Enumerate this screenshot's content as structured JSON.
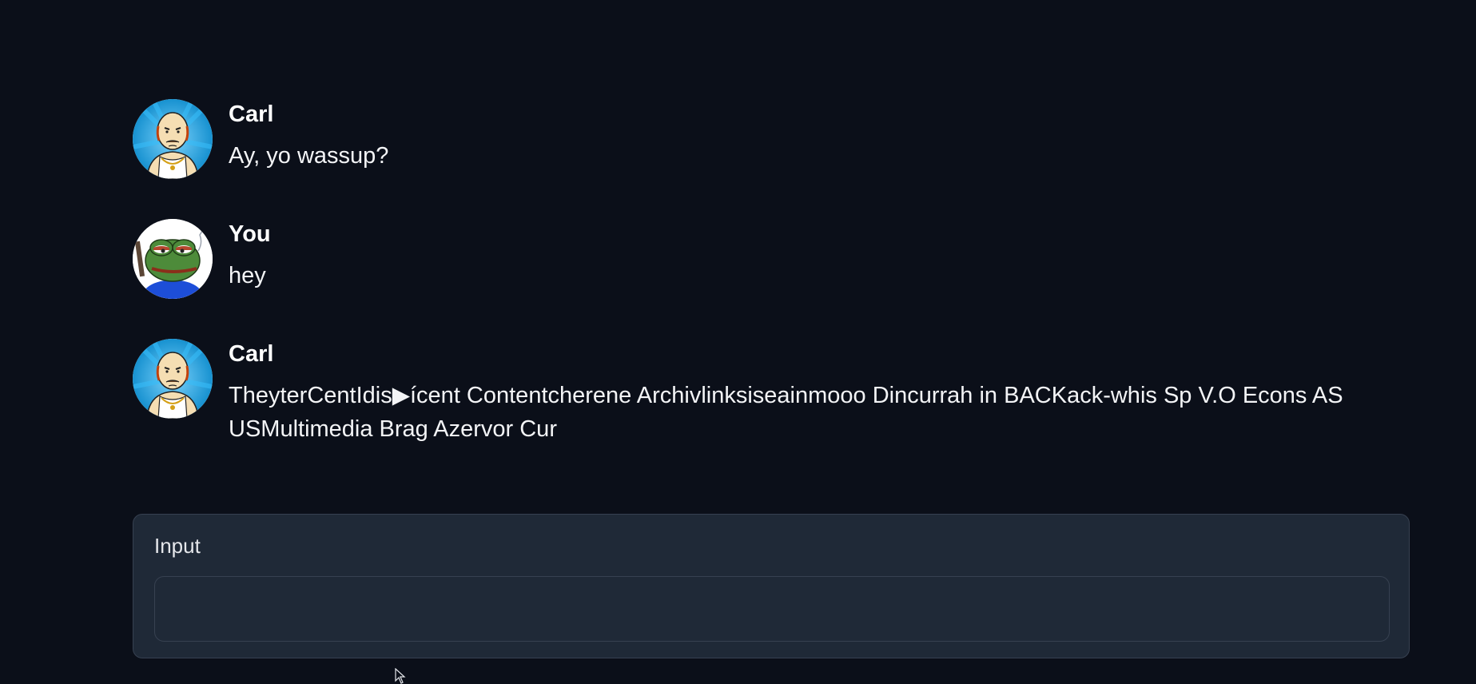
{
  "messages": [
    {
      "sender": "Carl",
      "avatar": "carl-avatar",
      "text": "Ay, yo wassup?"
    },
    {
      "sender": "You",
      "avatar": "frog-avatar",
      "text": "hey"
    },
    {
      "sender": "Carl",
      "avatar": "carl-avatar",
      "text": "TheyterCentIdis▶ícent Contentcherene Archivlinksiseainmooo Dincurrah in BACKack-whis Sp V.O Econs AS USMultimedia Brag Azervor Cur"
    }
  ],
  "input": {
    "label": "Input",
    "value": ""
  },
  "colors": {
    "background": "#0b0f19",
    "panel": "#1f2937",
    "border": "#374151",
    "text": "#e5e7eb"
  }
}
